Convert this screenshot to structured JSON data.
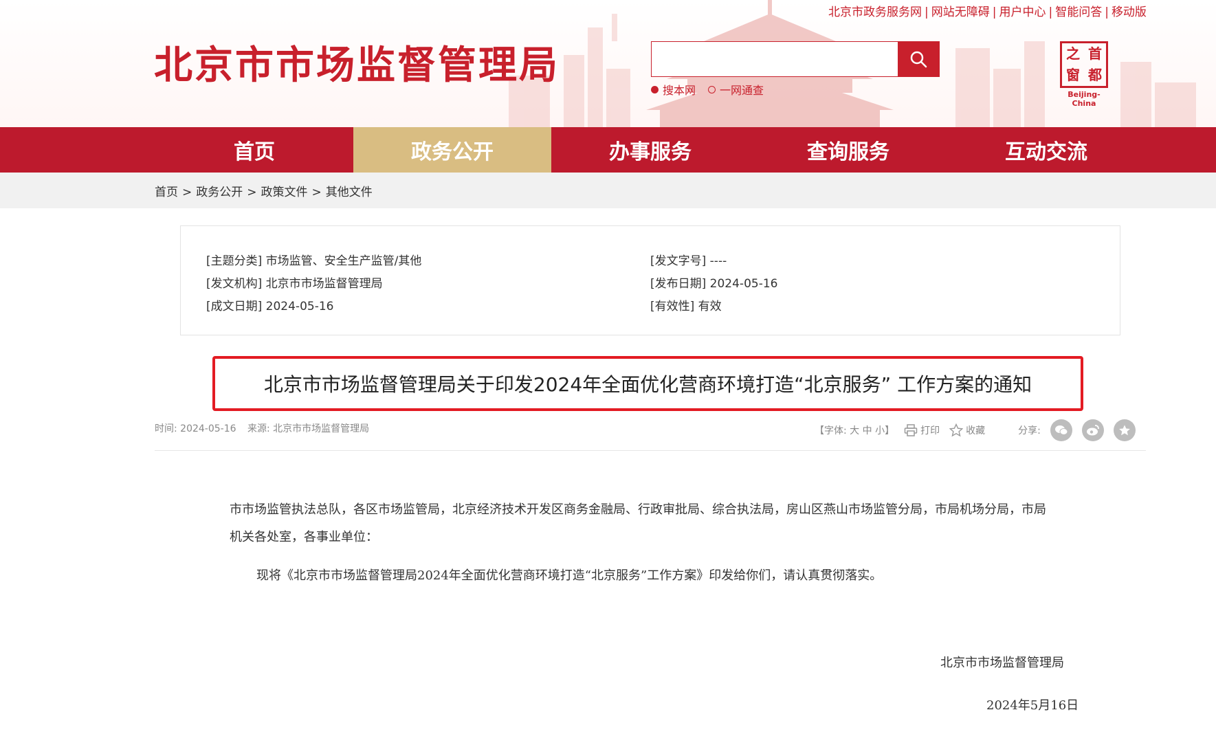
{
  "header": {
    "site_title": "北京市市场监督管理局",
    "top_links": [
      "北京市政务服务网",
      "网站无障碍",
      "用户中心",
      "智能问答",
      "移动版"
    ],
    "search": {
      "placeholder": ""
    },
    "search_scopes": [
      {
        "label": "搜本网",
        "selected": true
      },
      {
        "label": "一网通查",
        "selected": false
      }
    ],
    "badge": {
      "chars": [
        "首",
        "都",
        "之",
        "窗"
      ],
      "subtitle": "Beijing-China"
    }
  },
  "nav": {
    "items": [
      {
        "label": "首页",
        "active": false
      },
      {
        "label": "政务公开",
        "active": true
      },
      {
        "label": "办事服务",
        "active": false
      },
      {
        "label": "查询服务",
        "active": false
      },
      {
        "label": "互动交流",
        "active": false
      }
    ]
  },
  "breadcrumb": [
    "首页",
    "政务公开",
    "政策文件",
    "其他文件"
  ],
  "info": {
    "subject": {
      "label": "[主题分类]",
      "value": "市场监管、安全生产监管/其他"
    },
    "issuer": {
      "label": "[发文机构]",
      "value": "北京市市场监督管理局"
    },
    "created": {
      "label": "[成文日期]",
      "value": "2024-05-16"
    },
    "doc_no": {
      "label": "[发文字号]",
      "value": "----"
    },
    "published": {
      "label": "[发布日期]",
      "value": "2024-05-16"
    },
    "validity": {
      "label": "[有效性]",
      "value": "有效"
    }
  },
  "article": {
    "title": "北京市市场监督管理局关于印发2024年全面优化营商环境打造“北京服务” 工作方案的通知",
    "meta_time": "时间: 2024-05-16",
    "meta_source": "来源: 北京市市场监督管理局",
    "font_size_label": "【字体: 大 中 小】",
    "print_label": "打印",
    "favorite_label": "收藏",
    "share_label": "分享:",
    "para1": "市市场监管执法总队，各区市场监管局，北京经济技术开发区商务金融局、行政审批局、综合执法局，房山区燕山市场监管分局，市局机场分局，市局机关各处室，各事业单位：",
    "para2": "现将《北京市市场监督管理局2024年全面优化营商环境打造“北京服务”工作方案》印发给你们，请认真贯彻落实。",
    "signature": "北京市市场监督管理局",
    "date": "2024年5月16日"
  },
  "colors": {
    "brand_red": "#bd1a2d",
    "active_tab": "#d9bd82",
    "highlight_border": "#e31b23"
  }
}
